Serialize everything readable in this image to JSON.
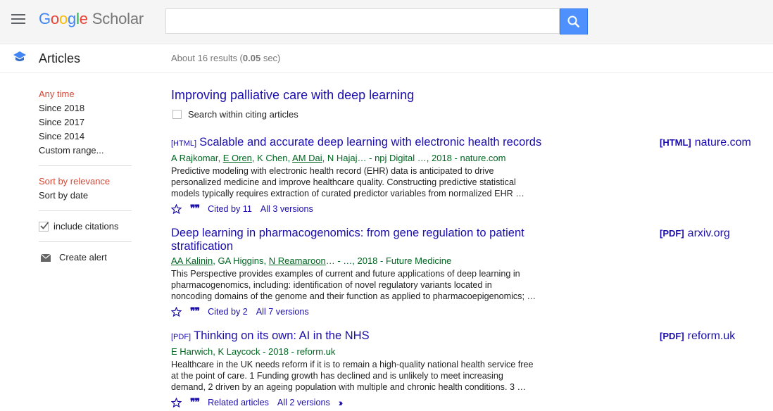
{
  "header": {
    "logo_letters": [
      "G",
      "o",
      "o",
      "g",
      "l",
      "e"
    ],
    "logo_suffix": "Scholar",
    "search_value": "",
    "search_placeholder": ""
  },
  "subheader": {
    "section": "Articles",
    "results_prefix": "About 16 results (",
    "results_time": "0.05",
    "results_suffix": " sec)"
  },
  "sidebar": {
    "time_items": [
      {
        "label": "Any time",
        "selected": true
      },
      {
        "label": "Since 2018",
        "selected": false
      },
      {
        "label": "Since 2017",
        "selected": false
      },
      {
        "label": "Since 2014",
        "selected": false
      },
      {
        "label": "Custom range...",
        "selected": false
      }
    ],
    "sort_items": [
      {
        "label": "Sort by relevance",
        "selected": true
      },
      {
        "label": "Sort by date",
        "selected": false
      }
    ],
    "include_citations": "include citations",
    "include_citations_checked": true,
    "create_alert": "Create alert"
  },
  "main": {
    "query_title": "Improving palliative care with deep learning",
    "search_within": "Search within citing articles"
  },
  "results": [
    {
      "tag": "[HTML]",
      "title": "Scalable and accurate deep learning with electronic health records",
      "authors": [
        {
          "name": "A Rajkomar",
          "linked": false
        },
        {
          "sep": ", "
        },
        {
          "name": "E Oren",
          "linked": true
        },
        {
          "sep": ", "
        },
        {
          "name": "K Chen",
          "linked": false
        },
        {
          "sep": ", "
        },
        {
          "name": "AM Dai",
          "linked": true
        },
        {
          "sep": ", "
        },
        {
          "name": "N Hajaj",
          "linked": false
        }
      ],
      "source": "… - npj Digital …, 2018 - nature.com",
      "snippet": [
        "Predictive modeling with electronic health record (EHR) data is anticipated to drive",
        "personalized medicine and improve healthcare quality. Constructing predictive statistical",
        "models typically requires extraction of curated predictor variables from normalized EHR …"
      ],
      "cited": "Cited by 11",
      "versions": "All 3 versions",
      "related": "",
      "side_tag": "[HTML]",
      "side_domain": "nature.com"
    },
    {
      "tag": "",
      "title": "Deep learning in pharmacogenomics: from gene regulation to patient stratification",
      "authors": [
        {
          "name": "AA Kalinin",
          "linked": true
        },
        {
          "sep": ", "
        },
        {
          "name": "GA Higgins",
          "linked": false
        },
        {
          "sep": ", "
        },
        {
          "name": "N Reamaroon",
          "linked": true
        }
      ],
      "source": "… - …, 2018 - Future Medicine",
      "snippet": [
        "This Perspective provides examples of current and future applications of deep learning in",
        "pharmacogenomics, including: identification of novel regulatory variants located in",
        "noncoding domains of the genome and their function as applied to pharmacoepigenomics; …"
      ],
      "cited": "Cited by 2",
      "versions": "All 7 versions",
      "related": "",
      "side_tag": "[PDF]",
      "side_domain": "arxiv.org"
    },
    {
      "tag": "[PDF]",
      "title": "Thinking on its own: AI in the NHS",
      "authors": [
        {
          "name": "E Harwich",
          "linked": false
        },
        {
          "sep": ", "
        },
        {
          "name": "K Laycock",
          "linked": false
        }
      ],
      "source": " - 2018 - reform.uk",
      "snippet": [
        "Healthcare in the UK needs reform if it is to remain a high-quality national health service free",
        "at the point of care. 1 Funding growth has declined and is unlikely to meet increasing",
        "demand, 2 driven by an ageing population with multiple and chronic health conditions. 3 …"
      ],
      "cited": "",
      "versions": "All 2 versions",
      "related": "Related articles",
      "side_tag": "[PDF]",
      "side_domain": "reform.uk"
    }
  ],
  "colors": {
    "link": "#1a0dab",
    "green": "#006621",
    "selected": "#d14836",
    "search_button": "#4d90fe"
  }
}
